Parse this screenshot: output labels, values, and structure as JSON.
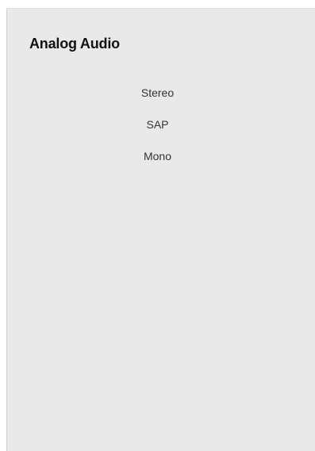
{
  "panel": {
    "title": "Analog Audio",
    "options": [
      {
        "label": "Stereo"
      },
      {
        "label": "SAP"
      },
      {
        "label": "Mono"
      }
    ]
  },
  "colors": {
    "panel_background": "#e9e9e9",
    "title_text": "#111111",
    "option_text": "#333333"
  }
}
